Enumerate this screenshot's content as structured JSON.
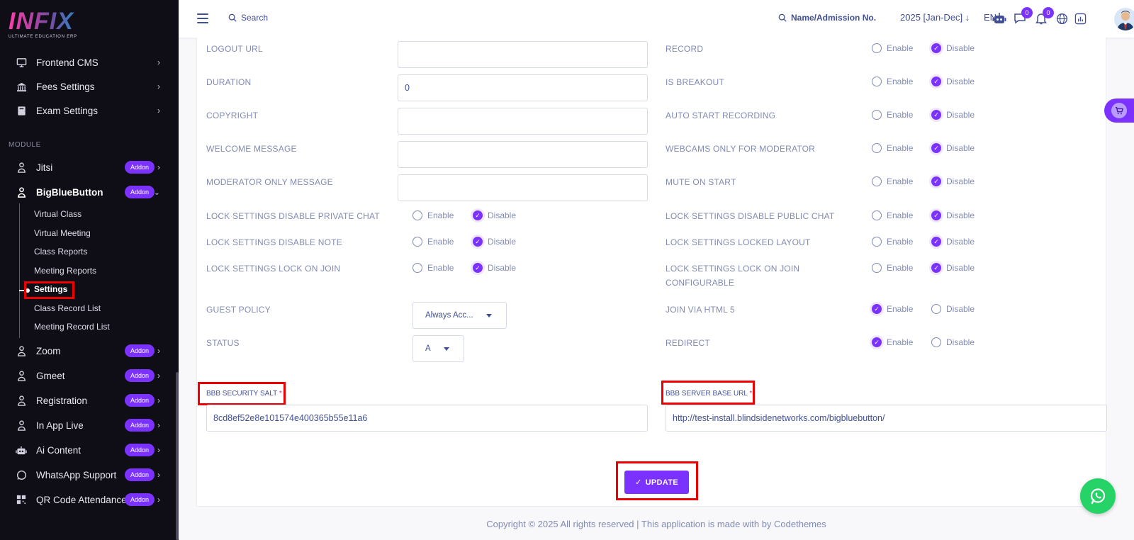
{
  "logo": {
    "brand": "INFIX",
    "tagline": "ULTIMATE EDUCATION ERP"
  },
  "sidebar": {
    "top_items": [
      {
        "label": "Frontend CMS",
        "icon": "monitor-icon"
      },
      {
        "label": "Fees Settings",
        "icon": "bank-icon"
      },
      {
        "label": "Exam Settings",
        "icon": "book-icon"
      }
    ],
    "module_label": "MODULE",
    "addon_label": "Addon",
    "modules": [
      {
        "label": "Jitsi",
        "addon": true
      },
      {
        "label": "BigBlueButton",
        "addon": true,
        "expanded": true
      },
      {
        "label": "Zoom",
        "addon": true
      },
      {
        "label": "Gmeet",
        "addon": true
      },
      {
        "label": "Registration",
        "addon": true
      },
      {
        "label": "In App Live",
        "addon": true
      },
      {
        "label": "Ai Content",
        "addon": true
      },
      {
        "label": "WhatsApp Support",
        "addon": true
      },
      {
        "label": "QR Code Attendance",
        "addon": true
      }
    ],
    "submenu": [
      "Virtual Class",
      "Virtual Meeting",
      "Class Reports",
      "Meeting Reports",
      "Settings",
      "Class Record List",
      "Meeting Record List"
    ],
    "active_submenu": "Settings"
  },
  "topbar": {
    "search_placeholder": "Search",
    "student_search": "Name/Admission No.",
    "academic_year": "2025 [Jan-Dec]",
    "language": "EN",
    "chat_badge": "0",
    "notif_badge": "0"
  },
  "form": {
    "left_fields": [
      {
        "label": "LOGOUT URL",
        "value": ""
      },
      {
        "label": "DURATION",
        "value": "0"
      },
      {
        "label": "COPYRIGHT",
        "value": ""
      },
      {
        "label": "WELCOME MESSAGE",
        "value": ""
      },
      {
        "label": "MODERATOR ONLY MESSAGE",
        "value": ""
      }
    ],
    "left_radios": [
      {
        "label": "LOCK SETTINGS DISABLE PRIVATE CHAT",
        "selected": "Disable"
      },
      {
        "label": "LOCK SETTINGS DISABLE NOTE",
        "selected": "Disable"
      },
      {
        "label": "LOCK SETTINGS LOCK ON JOIN",
        "selected": "Disable"
      }
    ],
    "guest_policy": {
      "label": "GUEST POLICY",
      "value": "Always Acc..."
    },
    "status": {
      "label": "STATUS",
      "value": "A"
    },
    "right_radios": [
      {
        "label": "RECORD",
        "selected": "Disable"
      },
      {
        "label": "IS BREAKOUT",
        "selected": "Disable"
      },
      {
        "label": "AUTO START RECORDING",
        "selected": "Disable"
      },
      {
        "label": "WEBCAMS ONLY FOR MODERATOR",
        "selected": "Disable"
      },
      {
        "label": "MUTE ON START",
        "selected": "Disable"
      },
      {
        "label": "LOCK SETTINGS DISABLE PUBLIC CHAT",
        "selected": "Disable"
      },
      {
        "label": "LOCK SETTINGS LOCKED LAYOUT",
        "selected": "Disable"
      },
      {
        "label": "LOCK SETTINGS LOCK ON JOIN",
        "label2": "CONFIGURABLE",
        "selected": "Disable"
      },
      {
        "label": "JOIN VIA HTML 5",
        "selected": "Enable"
      },
      {
        "label": "REDIRECT",
        "selected": "Enable"
      }
    ],
    "enable_label": "Enable",
    "disable_label": "Disable",
    "security_salt": {
      "label": "BBB SECURITY SALT",
      "required": "*",
      "value": "8cd8ef52e8e101574e400365b55e11a6"
    },
    "server_url": {
      "label": "BBB SERVER BASE URL",
      "required": "*",
      "value": "http://test-install.blindsidenetworks.com/bigbluebutton/"
    },
    "update_label": "UPDATE"
  },
  "footer": {
    "text": "Copyright © 2025 All rights reserved | This application is made with by Codethemes"
  },
  "colors": {
    "accent": "#7c32ff",
    "sidebar": "#0f0e17",
    "text": "#415094",
    "muted": "#828bb2",
    "highlight": "#ee0000",
    "whatsapp": "#25d366"
  }
}
